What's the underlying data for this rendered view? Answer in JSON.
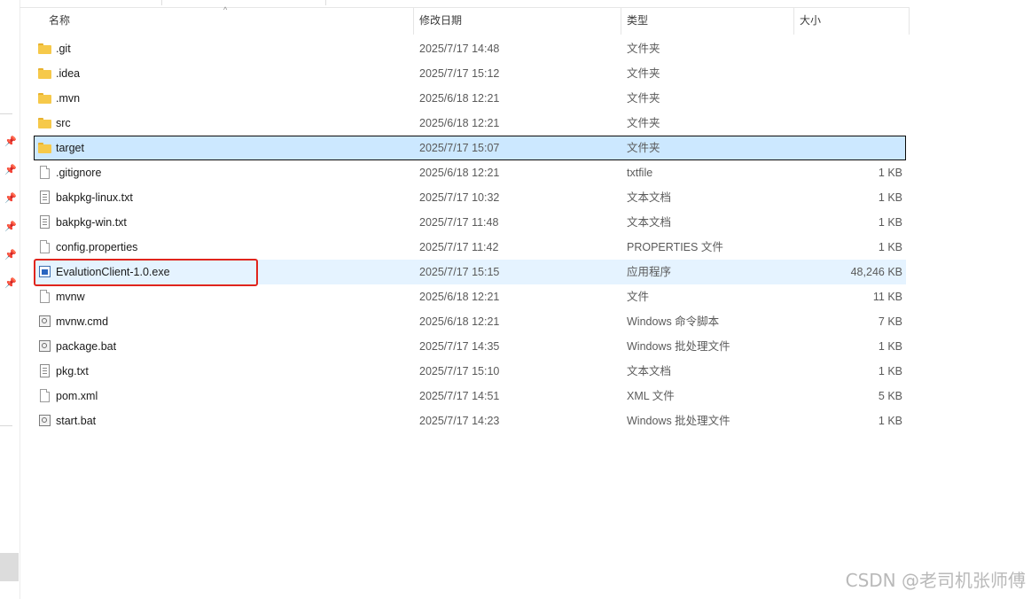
{
  "columns": {
    "name": "名称",
    "date": "修改日期",
    "type": "类型",
    "size": "大小"
  },
  "files": [
    {
      "name": ".git",
      "date": "2025/7/17 14:48",
      "type": "文件夹",
      "size": "",
      "icon": "folder-icon"
    },
    {
      "name": ".idea",
      "date": "2025/7/17 15:12",
      "type": "文件夹",
      "size": "",
      "icon": "folder-icon"
    },
    {
      "name": ".mvn",
      "date": "2025/6/18 12:21",
      "type": "文件夹",
      "size": "",
      "icon": "folder-icon"
    },
    {
      "name": "src",
      "date": "2025/6/18 12:21",
      "type": "文件夹",
      "size": "",
      "icon": "folder-icon"
    },
    {
      "name": "target",
      "date": "2025/7/17 15:07",
      "type": "文件夹",
      "size": "",
      "icon": "folder-icon"
    },
    {
      "name": ".gitignore",
      "date": "2025/6/18 12:21",
      "type": "txtfile",
      "size": "1 KB",
      "icon": "file-icon"
    },
    {
      "name": "bakpkg-linux.txt",
      "date": "2025/7/17 10:32",
      "type": "文本文档",
      "size": "1 KB",
      "icon": "text-file-icon"
    },
    {
      "name": "bakpkg-win.txt",
      "date": "2025/7/17 11:48",
      "type": "文本文档",
      "size": "1 KB",
      "icon": "text-file-icon"
    },
    {
      "name": "config.properties",
      "date": "2025/7/17 11:42",
      "type": "PROPERTIES 文件",
      "size": "1 KB",
      "icon": "file-icon"
    },
    {
      "name": "EvalutionClient-1.0.exe",
      "date": "2025/7/17 15:15",
      "type": "应用程序",
      "size": "48,246 KB",
      "icon": "exe-icon"
    },
    {
      "name": "mvnw",
      "date": "2025/6/18 12:21",
      "type": "文件",
      "size": "11 KB",
      "icon": "file-icon"
    },
    {
      "name": "mvnw.cmd",
      "date": "2025/6/18 12:21",
      "type": "Windows 命令脚本",
      "size": "7 KB",
      "icon": "script-icon"
    },
    {
      "name": "package.bat",
      "date": "2025/7/17 14:35",
      "type": "Windows 批处理文件",
      "size": "1 KB",
      "icon": "script-icon"
    },
    {
      "name": "pkg.txt",
      "date": "2025/7/17 15:10",
      "type": "文本文档",
      "size": "1 KB",
      "icon": "text-file-icon"
    },
    {
      "name": "pom.xml",
      "date": "2025/7/17 14:51",
      "type": "XML 文件",
      "size": "5 KB",
      "icon": "file-icon"
    },
    {
      "name": "start.bat",
      "date": "2025/7/17 14:23",
      "type": "Windows 批处理文件",
      "size": "1 KB",
      "icon": "script-icon"
    }
  ],
  "selected_index": 4,
  "hover_index": 9,
  "highlight_index": 9,
  "colors": {
    "selection": "#cce8ff",
    "hover": "#e5f3ff",
    "highlight_border": "#e0251d",
    "folder": "#f6c94a"
  },
  "watermark": "CSDN @老司机张师傅"
}
